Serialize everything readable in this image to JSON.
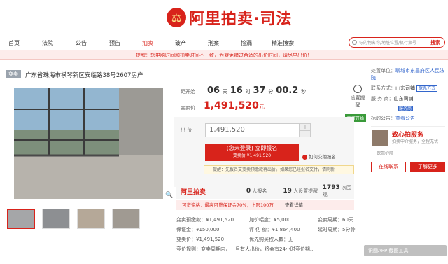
{
  "logo": {
    "emblem": "⚖",
    "brand": "阿里拍卖·司法"
  },
  "nav": [
    "首页",
    "法院",
    "公告",
    "预告",
    "拍卖",
    "破产",
    "刑案",
    "捡漏",
    "精准搜索"
  ],
  "search": {
    "placeholder": "标的物名称/地址位置/执行案号",
    "button": "搜索"
  },
  "notice": "提醒：您电脑时间和拍卖时间不一致，为避免错过合适的出价时间，请尽早出价！",
  "tag": "变卖",
  "title": "广东省珠海市横琴新区安临路38号2607房产",
  "countdown": {
    "label": "距开始",
    "d": "06",
    "dlabel": "天",
    "h": "16",
    "hlabel": "时",
    "m": "37",
    "mlabel": "分",
    "s": "00.2",
    "slabel": "秒"
  },
  "remind": "设置提醒",
  "price": {
    "label": "变卖价",
    "value": "1,491,520",
    "unit": "元"
  },
  "status": "即将开始",
  "bid": {
    "label": "出 价",
    "value": "1,491,520",
    "btn_line1": "(您未登录) 立即报名",
    "btn_line2": "变卖价 ¥1,491,520",
    "help": "如何交纳报名"
  },
  "tip": "提醒：先报名交变卖预缴款再出价。如果您已经报名交付，请刷新",
  "stats": {
    "brand": "阿里拍卖",
    "applicants": "0",
    "applicants_label": "人报名",
    "reminders": "19",
    "reminders_label": "人设置提醒",
    "views": "1793",
    "views_label": "次围观"
  },
  "loan": {
    "text": "可贷资格：最高可贷保证金70%，上限100万",
    "link": "查看详情"
  },
  "details": [
    {
      "k": "变卖预缴款：",
      "v": "¥1,491,520"
    },
    {
      "k": "加价幅度：",
      "v": "¥5,000"
    },
    {
      "k": "变卖周期：",
      "v": "60天"
    },
    {
      "k": "保证金：",
      "v": "¥150,000"
    },
    {
      "k": "评 估 价：",
      "v": "¥1,864,400"
    },
    {
      "k": "延时周期：",
      "v": "5分钟"
    },
    {
      "k": "变卖价：",
      "v": "¥1,491,520"
    },
    {
      "k": "优先购买权人数：",
      "v": "无"
    }
  ],
  "rule": "竞价规则：变卖周期内，一旦有人出价，将会有24小时竞价期...",
  "right": {
    "disposer_label": "处置单位：",
    "disposer": "聊城市东昌府区人民法院",
    "contact_label": "联系方式：",
    "contact": "山东司铺",
    "contact_badge": "联系方式",
    "service_label": "服 务 商：",
    "service": "山东司铺",
    "service_badge": "服务商",
    "platform_label": "标的公告：",
    "platform": "查看公告"
  },
  "court": {
    "title": "致心拍服务",
    "sub": "拍卖中介服务，全程无忧",
    "tag": "保驾护航"
  },
  "buttons": {
    "contact": "在线联系",
    "more": "了解更多"
  },
  "thumbs_count": 4,
  "watermark": "识图APP 截图工具"
}
